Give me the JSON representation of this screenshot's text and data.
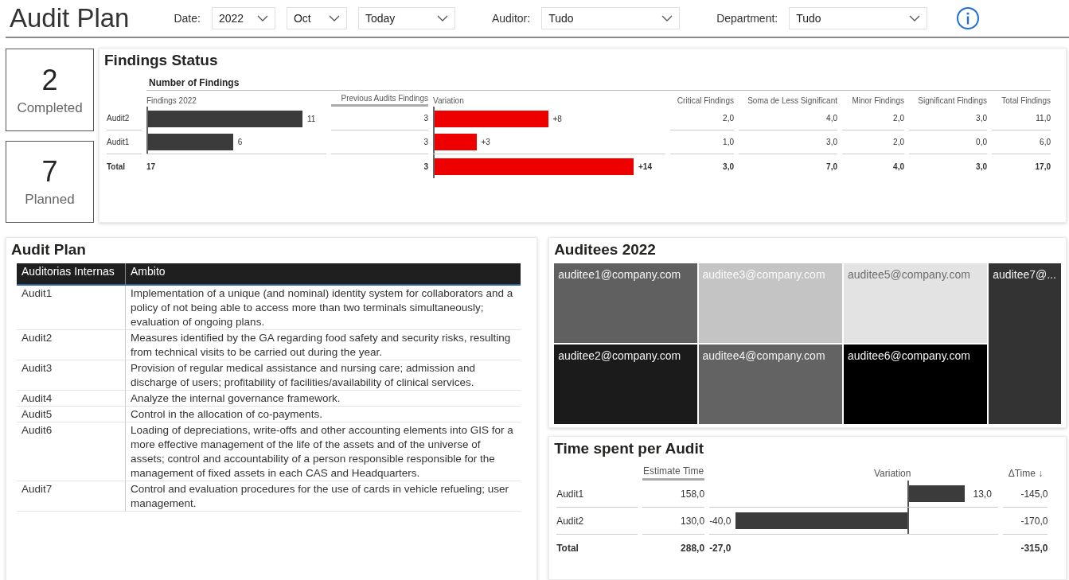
{
  "header": {
    "title": "Audit Plan",
    "filters": [
      {
        "label": "Date:",
        "dropdowns": [
          "2022",
          "Oct",
          "Today"
        ]
      },
      {
        "label": "Auditor:",
        "dropdowns": [
          "Tudo"
        ]
      },
      {
        "label": "Department:",
        "dropdowns": [
          "Tudo"
        ]
      }
    ]
  },
  "kpis": [
    {
      "value": "2",
      "label": "Completed"
    },
    {
      "value": "7",
      "label": "Planned"
    }
  ],
  "findings_status": {
    "title": "Findings Status",
    "group_header": "Number of Findings",
    "columns": [
      {
        "label": "Findings 2022",
        "sorted": false
      },
      {
        "label": "Previous Audits Findings",
        "sorted": true
      },
      {
        "label": "Variation",
        "sorted": false
      },
      {
        "label": "Critical Findings",
        "sorted": false
      },
      {
        "label": "Soma de Less Significant",
        "sorted": false
      },
      {
        "label": "Minor Findings",
        "sorted": false
      },
      {
        "label": "Significant Findings",
        "sorted": false
      },
      {
        "label": "Total Findings",
        "sorted": false
      }
    ],
    "rows": [
      {
        "kind": "row",
        "label": "Audit2",
        "findings": {
          "text": "11",
          "level": 1.0
        },
        "previous": "3",
        "variation": {
          "text": "+8",
          "level": 0.57
        },
        "values": [
          "2,0",
          "4,0",
          "2,0",
          "3,0",
          "11,0"
        ]
      },
      {
        "kind": "row",
        "label": "Audit1",
        "findings": {
          "text": "6",
          "level": 0.55
        },
        "previous": "3",
        "variation": {
          "text": "+3",
          "level": 0.21
        },
        "values": [
          "1,0",
          "3,0",
          "2,0",
          "0,0",
          "6,0"
        ]
      },
      {
        "kind": "total",
        "label": "Total",
        "findings": {
          "text": "17"
        },
        "previous": "3",
        "variation": {
          "text": "+14",
          "level": 1.0
        },
        "values": [
          "3,0",
          "7,0",
          "4,0",
          "3,0",
          "17,0"
        ]
      }
    ]
  },
  "audit_plan": {
    "title": "Audit Plan",
    "columns": [
      "Auditorias Internas",
      "Ambito"
    ],
    "rows": [
      [
        "Audit1",
        "Implementation of a unique (and nominal) identity system for collaborators and a policy of not being able to access more than two terminals simultaneously; evaluation of ongoing plans."
      ],
      [
        "Audit2",
        "Measures identified by the GA regarding food safety and security risks, resulting from technical visits to be carried out during the year."
      ],
      [
        "Audit3",
        "Provision of regular medical assistance and nursing care; admission and discharge of users; profitability of facilities/availability of clinical services."
      ],
      [
        "Audit4",
        "Analyze the internal governance framework."
      ],
      [
        "Audit5",
        "Control in the allocation of co-payments."
      ],
      [
        "Audit6",
        "Loading of depreciations, write-offs and other accounting elements into GIS for a more effective management of the life of the assets and of the universe of assets; control and accountability of a person responsible responsible for the management of fixed assets in each CAS and Headquarters."
      ],
      [
        "Audit7",
        "Control and evaluation procedures for the use of cards in vehicle refueling; user management."
      ]
    ]
  },
  "auditees": {
    "title": "Auditees 2022",
    "tiles": [
      {
        "label": "auditee1@company.com",
        "color": "#606060"
      },
      {
        "label": "auditee2@company.com",
        "color": "#1b1b1b"
      },
      {
        "label": "auditee3@company.com",
        "color": "#c4c4c4"
      },
      {
        "label": "auditee4@company.com",
        "color": "#636363"
      },
      {
        "label": "auditee5@company.com",
        "color": "#e3e3e3"
      },
      {
        "label": "auditee6@company.com",
        "color": "#000000"
      },
      {
        "label": "auditee7@...",
        "color": "#333333"
      }
    ]
  },
  "time_spent": {
    "title": "Time spent per Audit",
    "columns": [
      {
        "label": "Estimate Time",
        "sorted": true
      },
      {
        "label": "Variation",
        "sorted": false
      },
      {
        "label": "ΔTime ↓",
        "sorted": false
      }
    ],
    "rows": [
      {
        "kind": "row",
        "label": "Audit1",
        "estimate": "158,0",
        "variation": {
          "text": "13,0",
          "kind": "positive"
        },
        "delta": "-145,0"
      },
      {
        "kind": "row",
        "label": "Audit2",
        "estimate": "130,0",
        "variation": {
          "text": "-40,0",
          "level": 1.0,
          "kind": "negative"
        },
        "delta": "-170,0"
      },
      {
        "kind": "total",
        "label": "Total",
        "estimate": "288,0",
        "variation": {
          "text": "-27,0"
        },
        "delta": "-315,0"
      }
    ]
  }
}
